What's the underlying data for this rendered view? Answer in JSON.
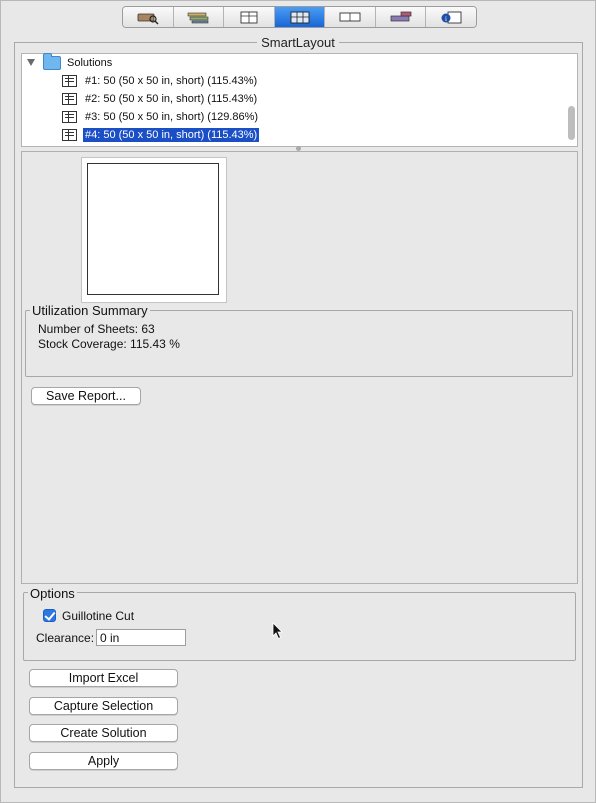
{
  "toolbar": {
    "tools": [
      {
        "icon": "scan-sofa-icon"
      },
      {
        "icon": "stacked-boards-icon"
      },
      {
        "icon": "cabinet-outline-icon"
      },
      {
        "icon": "smartlayout-icon",
        "active": true
      },
      {
        "icon": "panel-icon"
      },
      {
        "icon": "cut-board-icon"
      },
      {
        "icon": "info-cabinet-icon"
      }
    ]
  },
  "panel": {
    "title": "SmartLayout"
  },
  "tree": {
    "root_label": "Solutions",
    "solutions": [
      {
        "label": "#1: 50 (50 x 50 in, short) (115.43%)"
      },
      {
        "label": "#2: 50 (50 x 50 in, short) (115.43%)"
      },
      {
        "label": "#3: 50 (50 x 50 in, short) (129.86%)"
      },
      {
        "label": "#4: 50 (50 x 50 in, short) (115.43%)",
        "selected": true
      }
    ]
  },
  "summary": {
    "title": "Utilization Summary",
    "sheets": "Number of Sheets: 63",
    "coverage": "Stock Coverage: 115.43 %",
    "save_button": "Save Report..."
  },
  "options": {
    "title": "Options",
    "guillotine_label": "Guillotine Cut",
    "guillotine_checked": true,
    "clearance_label": "Clearance:",
    "clearance_value": "0 in"
  },
  "actions": {
    "import_excel": "Import Excel",
    "capture_selection": "Capture Selection",
    "create_solution": "Create Solution",
    "apply": "Apply"
  },
  "colors": {
    "accent": "#1a4fc6",
    "toolbar_active": "#1866d6",
    "checkbox": "#2c77e3"
  }
}
